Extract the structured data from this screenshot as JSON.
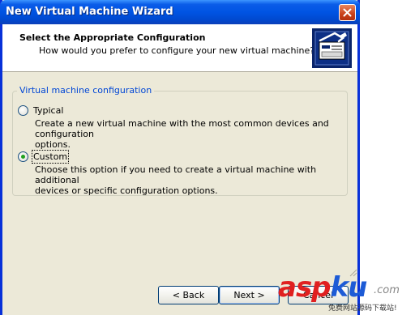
{
  "window": {
    "title": "New Virtual Machine Wizard"
  },
  "header": {
    "title": "Select the Appropriate Configuration",
    "subtitle": "How would you prefer to configure your new virtual machine?",
    "icon": "vm-wizard-icon"
  },
  "config_group": {
    "label": "Virtual machine configuration",
    "options": [
      {
        "label": "Typical",
        "description_line1": "Create a new virtual machine with the most common devices and configuration",
        "description_line2": "options.",
        "selected": false
      },
      {
        "label": "Custom",
        "description_line1": "Choose this option if you need to create a virtual machine with additional",
        "description_line2": "devices or specific configuration options.",
        "selected": true
      }
    ]
  },
  "buttons": {
    "back": "< Back",
    "next": "Next >",
    "cancel": "Cancel"
  },
  "watermark": {
    "text_a": "asp",
    "text_b": "ku",
    "domain": ".com",
    "subtitle": "免费网站源码下载站!"
  },
  "colors": {
    "title_bar": "#0054e3",
    "group_label": "#0046d5",
    "window_bg": "#ece9d8",
    "watermark_red": "#e02020",
    "watermark_blue": "#1d5bd6"
  }
}
